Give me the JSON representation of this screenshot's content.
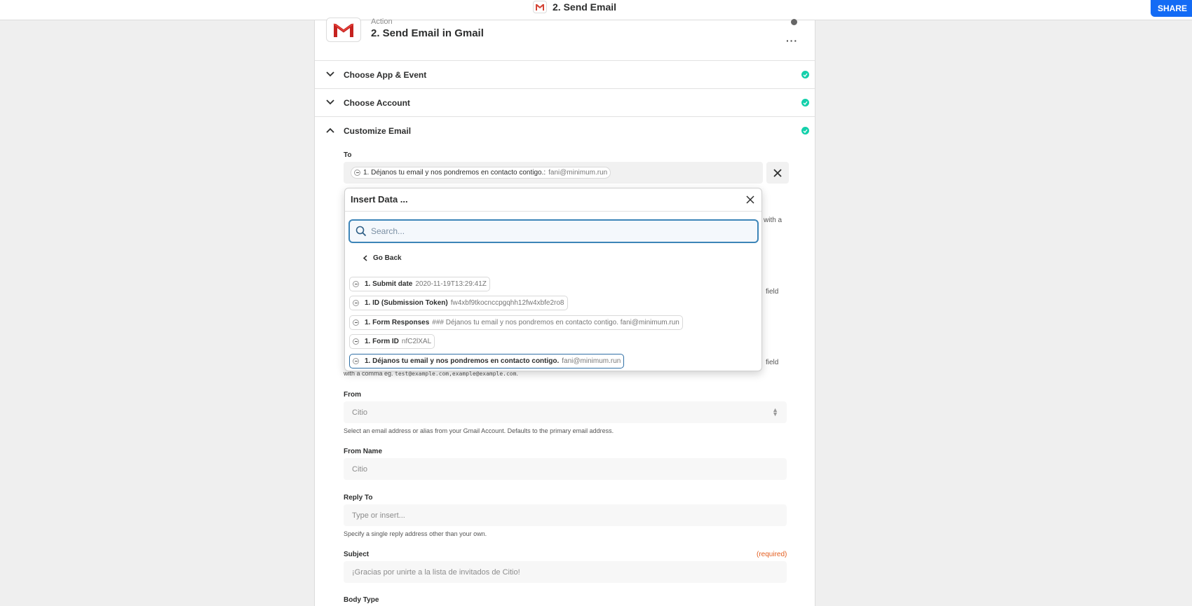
{
  "topbar": {
    "title": "2. Send Email",
    "share_label": "SHARE"
  },
  "step": {
    "type_label": "Action",
    "title": "2. Send Email in Gmail",
    "more_label": "···"
  },
  "sections": [
    {
      "label": "Choose App & Event"
    },
    {
      "label": "Choose Account"
    },
    {
      "label": "Customize Email"
    }
  ],
  "fields": {
    "to": {
      "label": "To",
      "pill_name": "1. Déjanos tu email y nos pondremos en contacto contigo.:",
      "pill_value": "fani@minimum.run"
    },
    "peek_texts": [
      "with a",
      "field",
      "field"
    ],
    "cc_help_prefix": "with a comma eg.",
    "cc_help_code": "test@example.com,example@example.com",
    "from": {
      "label": "From",
      "value": "Citio",
      "help": "Select an email address or alias from your Gmail Account. Defaults to the primary email address."
    },
    "from_name": {
      "label": "From Name",
      "value": "Citio"
    },
    "reply_to": {
      "label": "Reply To",
      "placeholder": "Type or insert...",
      "help": "Specify a single reply address other than your own."
    },
    "subject": {
      "label": "Subject",
      "required": "(required)",
      "value": "¡Gracias por unirte a la lista de invitados de Citio!"
    },
    "body_type": {
      "label": "Body Type"
    }
  },
  "insert_data": {
    "title": "Insert Data ...",
    "search_placeholder": "Search...",
    "go_back": "Go Back",
    "items": [
      {
        "name": "1. Submit date",
        "value": "2020-11-19T13:29:41Z"
      },
      {
        "name": "1. ID (Submission Token)",
        "value": "fw4xbf9tkocnccpgqhh12fw4xbfe2ro8"
      },
      {
        "name": "1. Form Responses",
        "value": "### Déjanos tu email y nos pondremos en contacto contigo. fani@minimum.run"
      },
      {
        "name": "1. Form ID",
        "value": "nfC2lXAL"
      },
      {
        "name": "1. Déjanos tu email y nos pondremos en contacto contigo.",
        "value": "fani@minimum.run"
      }
    ]
  },
  "colors": {
    "accent": "#136bf5",
    "check": "#13d0ab",
    "required": "#e35d1e",
    "focus": "#3d85b8"
  }
}
